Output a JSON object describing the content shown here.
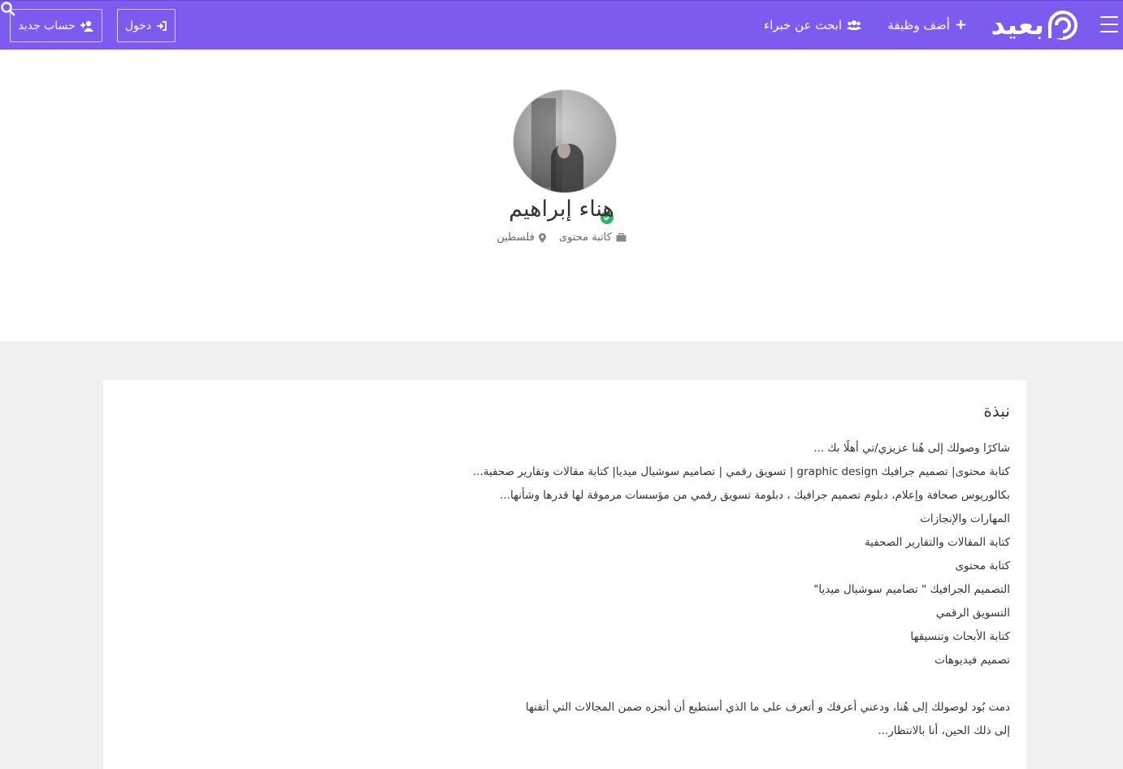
{
  "nav": {
    "logo_text": "بعيد",
    "add_job": "أضف وظيفة",
    "find_experts": "ابحث عن خبراء",
    "login": "دخول",
    "register": "حساب جديد"
  },
  "profile": {
    "name": "هناء إبراهيم",
    "job_title": "كاتبة محتوى",
    "location": "فلسطين",
    "verified": true
  },
  "bio": {
    "title": "نبذة",
    "lines": [
      "شاكرًا وصولك إلى هُنا عزيزي/تي أهلًا بك ...",
      "كتابة محتوى| تصميم جرافيك graphic design | تسويق رقمي | تصاميم سوشيال ميديا| كتابة مقالات وتقارير صحفية...",
      "بكالوريوس صحافة وإعلام، دبلوم تصميم جرافيك ، دبلومة تسويق رقمي من مؤسسات مرموقة لها قدرها وشأنها...",
      "المهارات والإنجازات",
      "كتابة المقالات والتقارير الصحفية",
      "كتابة محتوى",
      "التصميم الجرافيك \" تصاميم سوشيال ميديا\"",
      "التسويق الرقمي",
      "كتابة الأبحاث وتنسيقها",
      "تصميم فيديوهات",
      "",
      "دمت بُود لوصولك إلى هُنا، ودعني أعرفك و أتعرف على ما الذي أستطيع أن أنجزه ضمن المجالات التي أتقنها",
      "إلى ذلك الحين، أنا بالانتظار..."
    ]
  },
  "colors": {
    "navbar": "#7e5bef",
    "verified": "#2db36b",
    "page_bg": "#f0f0f0"
  }
}
